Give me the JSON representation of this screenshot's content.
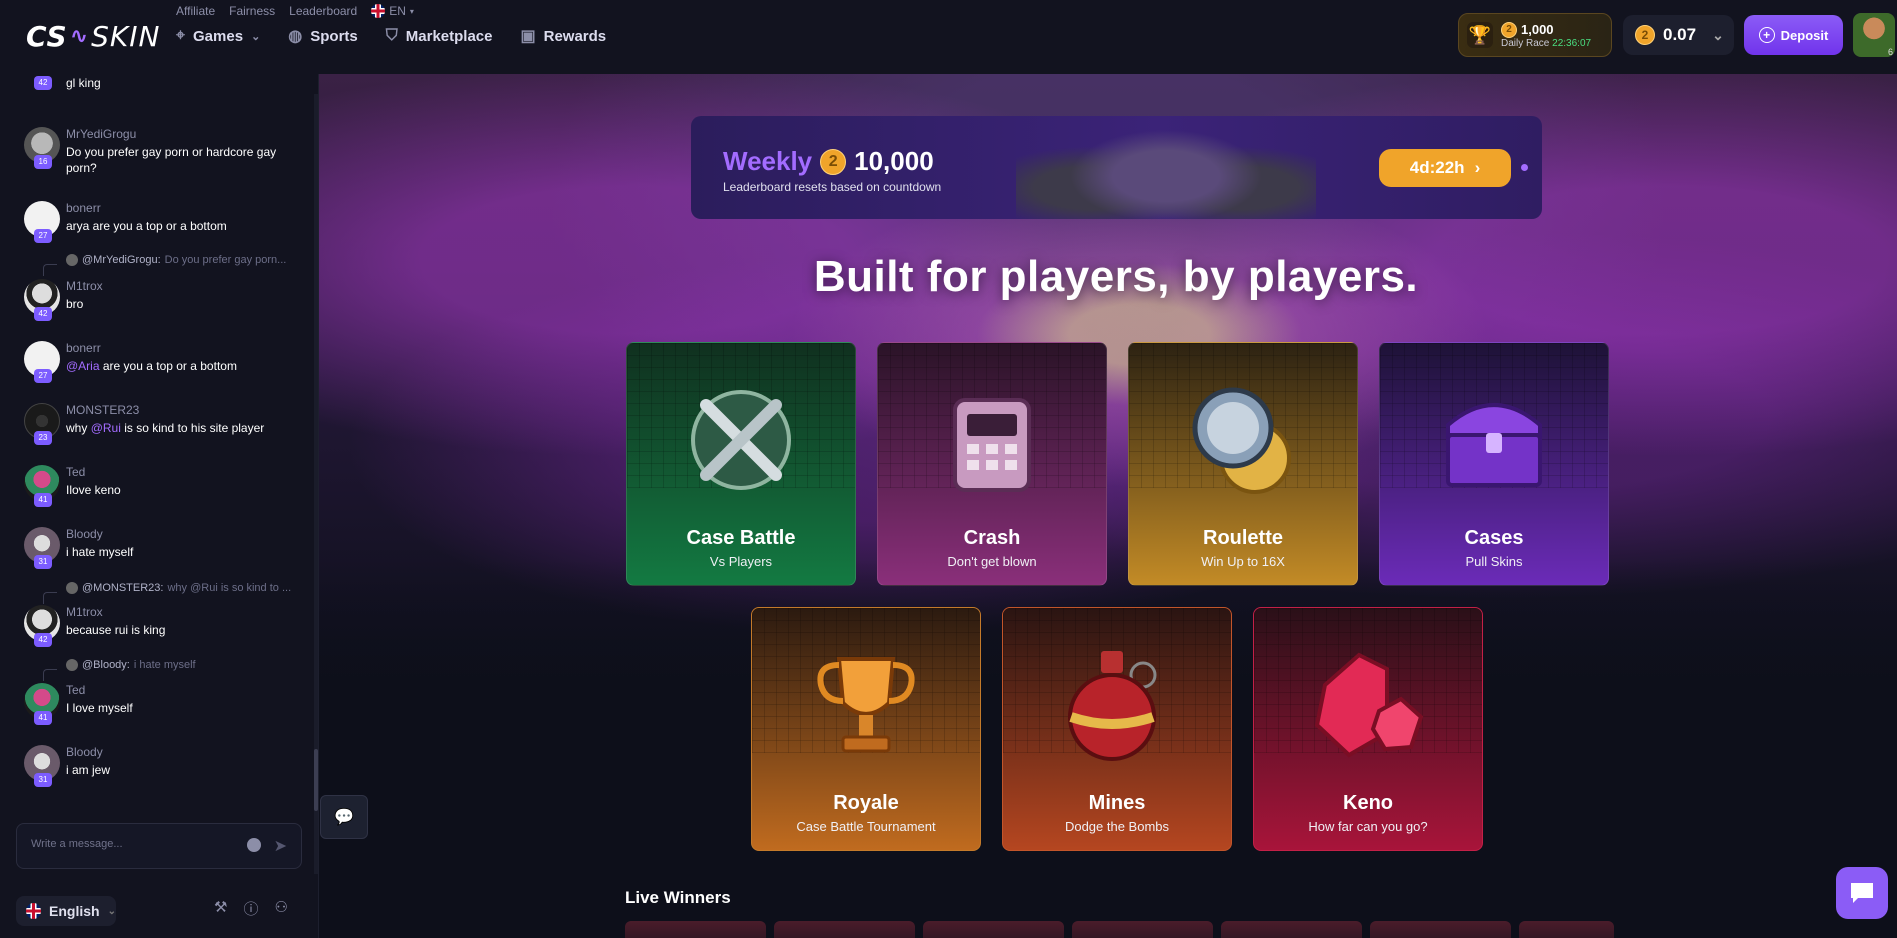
{
  "brand": {
    "logo_left": "CS",
    "logo_right": "SKIN"
  },
  "top_links": [
    "Affiliate",
    "Fairness",
    "Leaderboard"
  ],
  "language_short": "EN",
  "nav": [
    {
      "label": "Games",
      "icon": "crosshair-icon",
      "has_dropdown": true
    },
    {
      "label": "Sports",
      "icon": "ball-icon"
    },
    {
      "label": "Marketplace",
      "icon": "basket-icon"
    },
    {
      "label": "Rewards",
      "icon": "gift-icon"
    }
  ],
  "race": {
    "amount": "1,000",
    "label": "Daily Race",
    "timer": "22:36:07"
  },
  "balance": {
    "value": "0.07"
  },
  "deposit_label": "Deposit",
  "user_level": "6",
  "chat": {
    "messages": [
      {
        "user": "",
        "text": "gl king",
        "level": "42"
      },
      {
        "user": "MrYediGrogu",
        "text": "Do you prefer gay porn or hardcore gay porn?",
        "level": "16"
      },
      {
        "user": "bonerr",
        "text": "arya are you a top or a bottom",
        "level": "27"
      },
      {
        "reply_to": "@MrYediGrogu:",
        "reply_text": "Do you prefer gay porn..."
      },
      {
        "user": "M1trox",
        "text": "bro",
        "level": "42"
      },
      {
        "user": "bonerr",
        "mention": "@Aria",
        "text": " are you a top or a bottom",
        "level": "27"
      },
      {
        "user": "MONSTER23",
        "pre": "why ",
        "mention": "@Rui",
        "text": " is so kind to his site player",
        "level": "23"
      },
      {
        "user": "Ted",
        "text": "Ilove keno",
        "level": "41"
      },
      {
        "user": "Bloody",
        "text": "i hate myself",
        "level": "31"
      },
      {
        "reply_to": "@MONSTER23:",
        "reply_text": "why @Rui is so kind to ..."
      },
      {
        "user": "M1trox",
        "text": "because rui is king",
        "level": "42"
      },
      {
        "reply_to": "@Bloody:",
        "reply_text": "i hate myself"
      },
      {
        "user": "Ted",
        "text": "I love myself",
        "level": "41"
      },
      {
        "user": "Bloody",
        "text": "i am jew",
        "level": "31"
      }
    ],
    "input_placeholder": "Write a message...",
    "language": "English"
  },
  "weekly": {
    "title": "Weekly",
    "amount": "10,000",
    "description": "Leaderboard resets based on countdown",
    "countdown": "4d:22h"
  },
  "headline": "Built for players, by players.",
  "games": [
    {
      "title": "Case Battle",
      "subtitle": "Vs Players"
    },
    {
      "title": "Crash",
      "subtitle": "Don't get blown"
    },
    {
      "title": "Roulette",
      "subtitle": "Win Up to 16X"
    },
    {
      "title": "Cases",
      "subtitle": "Pull Skins"
    },
    {
      "title": "Royale",
      "subtitle": "Case Battle Tournament"
    },
    {
      "title": "Mines",
      "subtitle": "Dodge the Bombs"
    },
    {
      "title": "Keno",
      "subtitle": "How far can you go?"
    }
  ],
  "live_winners_title": "Live Winners",
  "colors": {
    "accent": "#8b5cf6",
    "gold": "#f0a42a",
    "bg": "#0d0f1a"
  }
}
